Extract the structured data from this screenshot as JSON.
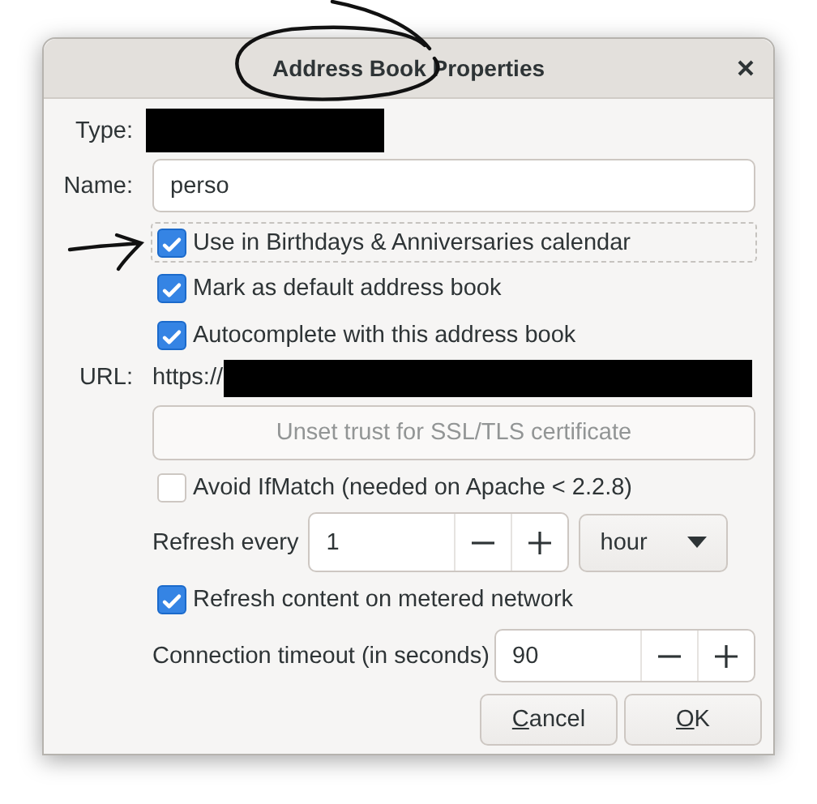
{
  "window": {
    "title": "Address Book Properties",
    "title_circled": true
  },
  "type": {
    "label": "Type:",
    "redacted": true
  },
  "name": {
    "label": "Name:",
    "value": "perso"
  },
  "options": [
    {
      "label": "Use in Birthdays & Anniversaries calendar",
      "checked": true,
      "focused": true,
      "arrow_marked": true
    },
    {
      "label": "Mark as default address book",
      "checked": true,
      "focused": false,
      "arrow_marked": false
    },
    {
      "label": "Autocomplete with this address book",
      "checked": true,
      "focused": false,
      "arrow_marked": false
    }
  ],
  "url": {
    "label": "URL:",
    "value": "https://",
    "redacted": true
  },
  "unset_trust_button": {
    "label": "Unset trust for SSL/TLS certificate",
    "disabled": true
  },
  "avoid_ifmatch": {
    "label": "Avoid IfMatch (needed on Apache < 2.2.8)",
    "checked": false
  },
  "refresh": {
    "label": "Refresh every",
    "value": "1",
    "unit": "hour"
  },
  "refresh_metered": {
    "label": "Refresh content on metered network",
    "checked": true
  },
  "timeout": {
    "label": "Connection timeout (in seconds)",
    "value": "90"
  },
  "buttons": [
    {
      "label": "Cancel",
      "mnemonic": true
    },
    {
      "label": "OK",
      "mnemonic": true
    }
  ]
}
